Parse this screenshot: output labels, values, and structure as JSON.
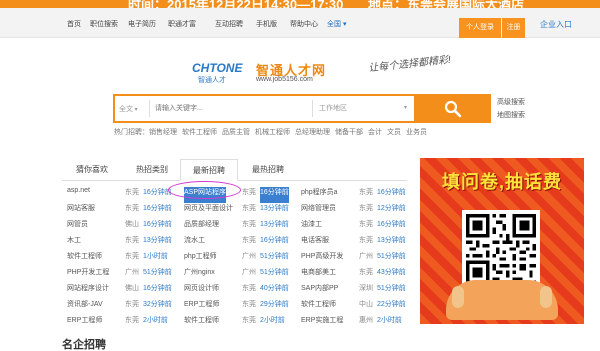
{
  "banner": {
    "time_label": "时间：2015年12月22日14:30—17:30",
    "place_label": "地点：东莞会展国际大酒店"
  },
  "nav": {
    "items": [
      "首页",
      "职位搜索",
      "电子简历",
      "职通才富",
      "互动招聘",
      "手机版",
      "帮助中心",
      "全国"
    ],
    "active_index": 7,
    "login_label": "个人登录",
    "register_label": "注册",
    "enterprise_label": "企业入口"
  },
  "logo": {
    "brand_en": "CHTONE",
    "brand_cn_small": "智通人才",
    "brand_cn": "智通人才网",
    "url": "www.job5156.com",
    "slogan": "让每个选择都精彩!"
  },
  "search": {
    "scope_label": "全文",
    "keyword_placeholder": "请输入关键字...",
    "area_label": "工作地区",
    "advanced_label": "高级搜索",
    "map_label": "地图搜索"
  },
  "hot_search": {
    "label": "热门招聘：",
    "items": [
      "销售经理",
      "软件工程师",
      "品质主管",
      "机械工程师",
      "总经理助理",
      "储备干部",
      "会计",
      "文员",
      "业务员"
    ]
  },
  "tabs": [
    {
      "label": "猜你喜欢"
    },
    {
      "label": "热招类别"
    },
    {
      "label": "最新招聘"
    },
    {
      "label": "最热招聘"
    }
  ],
  "active_tab": 2,
  "jobs": [
    [
      {
        "name": "asp.net",
        "city": "东莞",
        "time": "16分钟前"
      },
      {
        "name": "ASP网站程序",
        "city": "东莞",
        "time": "16分钟前"
      },
      {
        "name": "php程序员a",
        "city": "东莞",
        "time": "16分钟前"
      }
    ],
    [
      {
        "name": "网站客服",
        "city": "东莞",
        "time": "16分钟前"
      },
      {
        "name": "网页及平面设计",
        "city": "东莞",
        "time": "13分钟前"
      },
      {
        "name": "网络管理员",
        "city": "东莞",
        "time": "12分钟前"
      }
    ],
    [
      {
        "name": "网管员",
        "city": "佛山",
        "time": "16分钟前"
      },
      {
        "name": "品质部经理",
        "city": "东莞",
        "time": "13分钟前"
      },
      {
        "name": "油漆工",
        "city": "东莞",
        "time": "16分钟前"
      }
    ],
    [
      {
        "name": "木工",
        "city": "东莞",
        "time": "13分钟前"
      },
      {
        "name": "流水工",
        "city": "东莞",
        "time": "16分钟前"
      },
      {
        "name": "电话客服",
        "city": "东莞",
        "time": "13分钟前"
      }
    ],
    [
      {
        "name": "软件工程师",
        "city": "东莞",
        "time": "1小时前"
      },
      {
        "name": "php工程师",
        "city": "广州",
        "time": "51分钟前"
      },
      {
        "name": "PHP高级开发",
        "city": "广州",
        "time": "51分钟前"
      }
    ],
    [
      {
        "name": "PHP开发工程",
        "city": "广州",
        "time": "51分钟前"
      },
      {
        "name": "广州nginx",
        "city": "广州",
        "time": "51分钟前"
      },
      {
        "name": "电商部美工",
        "city": "东莞",
        "time": "43分钟前"
      }
    ],
    [
      {
        "name": "网站程序设计",
        "city": "佛山",
        "time": "16分钟前"
      },
      {
        "name": "网页设计师",
        "city": "东莞",
        "time": "40分钟前"
      },
      {
        "name": "SAP内部PP",
        "city": "深圳",
        "time": "51分钟前"
      }
    ],
    [
      {
        "name": "资讯部-JAV",
        "city": "东莞",
        "time": "32分钟前"
      },
      {
        "name": "ERP工程师",
        "city": "东莞",
        "time": "29分钟前"
      },
      {
        "name": "软件工程师",
        "city": "中山",
        "time": "22分钟前"
      }
    ],
    [
      {
        "name": "ERP工程师",
        "city": "东莞",
        "time": "2小时前"
      },
      {
        "name": "软件工程师",
        "city": "东莞",
        "time": "2小时前"
      },
      {
        "name": "ERP实施工程",
        "city": "惠州",
        "time": "2小时前"
      }
    ]
  ],
  "ad": {
    "title": "填问卷,抽话费"
  },
  "bottom": {
    "famous_label": "名企招聘"
  }
}
